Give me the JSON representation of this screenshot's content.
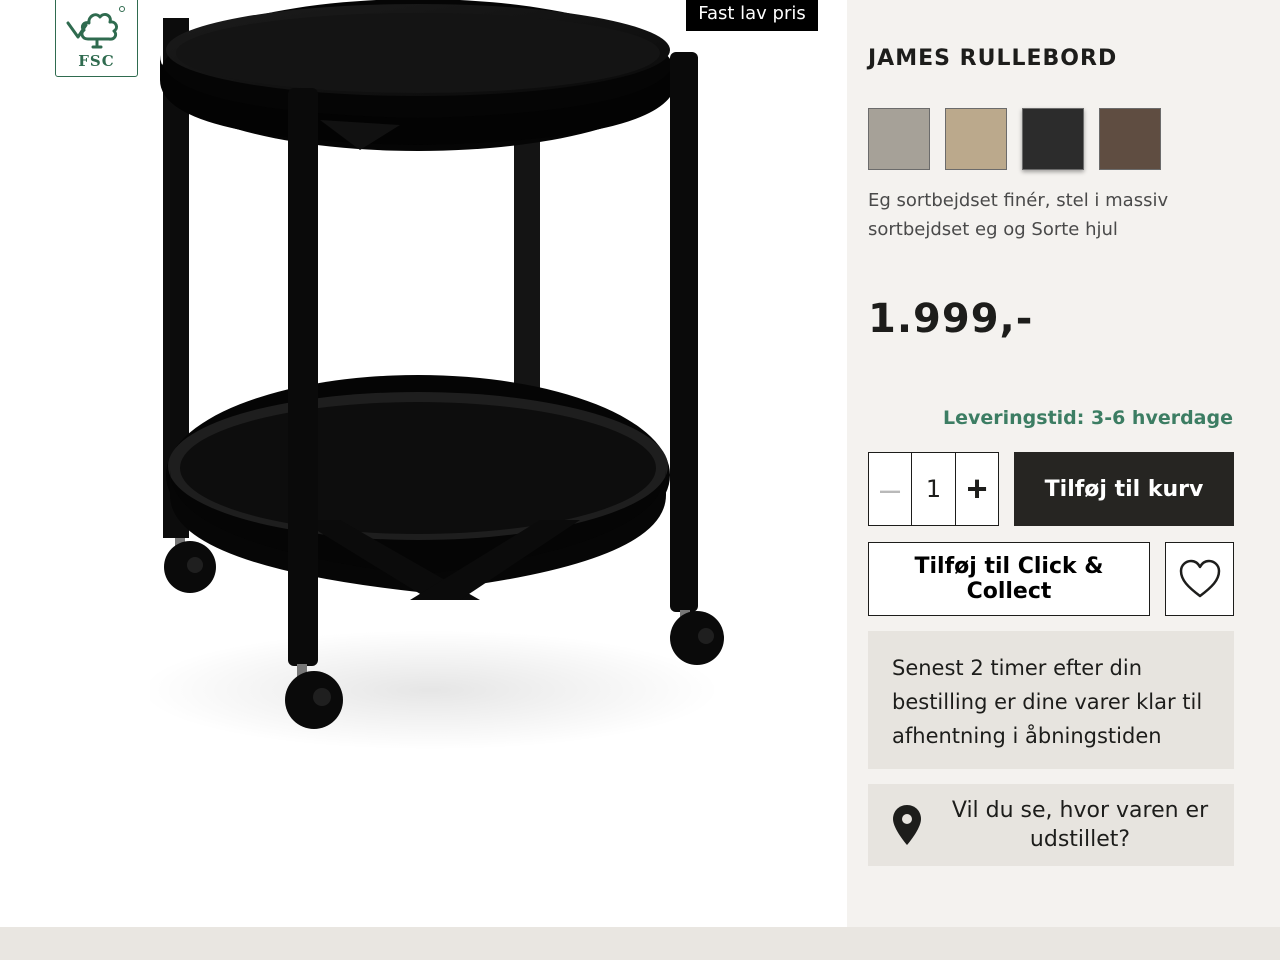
{
  "badges": {
    "fsc_label": "FSC",
    "price_tag": "Fast lav pris"
  },
  "product": {
    "brand": "JAMES",
    "name": "RULLEBORD",
    "description": "Eg sortbejdset finér, stel i massiv sortbejdset eg og Sorte hjul",
    "price": "1.999,-",
    "delivery": "Leveringstid: 3-6 hverdage"
  },
  "swatches": [
    {
      "color": "#a6a198",
      "label": "grey"
    },
    {
      "color": "#bba98c",
      "label": "oak"
    },
    {
      "color": "#2c2c2c",
      "label": "black",
      "selected": true
    },
    {
      "color": "#5f4d41",
      "label": "brown"
    }
  ],
  "quantity": {
    "minus": "–",
    "value": "1",
    "plus": "+"
  },
  "buttons": {
    "add_to_cart": "Tilføj til kurv",
    "click_collect": "Tilføj til Click & Collect"
  },
  "info": {
    "pickup_text": "Senest 2 timer efter din bestilling er dine varer klar til afhentning i åbningstiden",
    "store_text": "Vil du se, hvor varen er udstillet?"
  }
}
